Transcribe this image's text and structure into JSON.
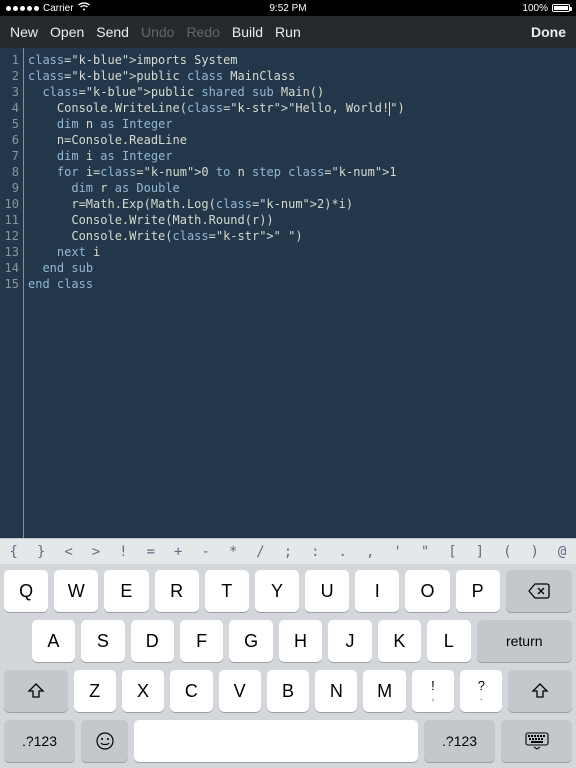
{
  "status": {
    "carrier": "Carrier",
    "time": "9:52 PM",
    "battery": "100%"
  },
  "toolbar": {
    "new": "New",
    "open": "Open",
    "send": "Send",
    "undo": "Undo",
    "redo": "Redo",
    "build": "Build",
    "run": "Run",
    "done": "Done"
  },
  "code_lines": [
    "imports System",
    "public class MainClass",
    "  public shared sub Main()",
    "    Console.WriteLine(\"Hello, World!\")",
    "    dim n as Integer",
    "    n=Console.ReadLine",
    "    dim i as Integer",
    "    for i=0 to n step 1",
    "      dim r as Double",
    "      r=Math.Exp(Math.Log(2)*i)",
    "      Console.Write(Math.Round(r))",
    "      Console.Write(\" \")",
    "    next i",
    "  end sub",
    "end class"
  ],
  "symbols": [
    "{",
    "}",
    "<",
    ">",
    "!",
    "=",
    "+",
    "-",
    "*",
    "/",
    ";",
    ":",
    ".",
    ",",
    "'",
    "\"",
    "[",
    "]",
    "(",
    ")",
    "@"
  ],
  "keyboard": {
    "row1": [
      "Q",
      "W",
      "E",
      "R",
      "T",
      "Y",
      "U",
      "I",
      "O",
      "P"
    ],
    "row2": [
      "A",
      "S",
      "D",
      "F",
      "G",
      "H",
      "J",
      "K",
      "L"
    ],
    "row3": [
      "Z",
      "X",
      "C",
      "V",
      "B",
      "N",
      "M"
    ],
    "dual1": {
      "top": "!",
      "bot": ","
    },
    "dual2": {
      "top": "?",
      "bot": "."
    },
    "numkey": ".?123",
    "returnkey": "return"
  }
}
